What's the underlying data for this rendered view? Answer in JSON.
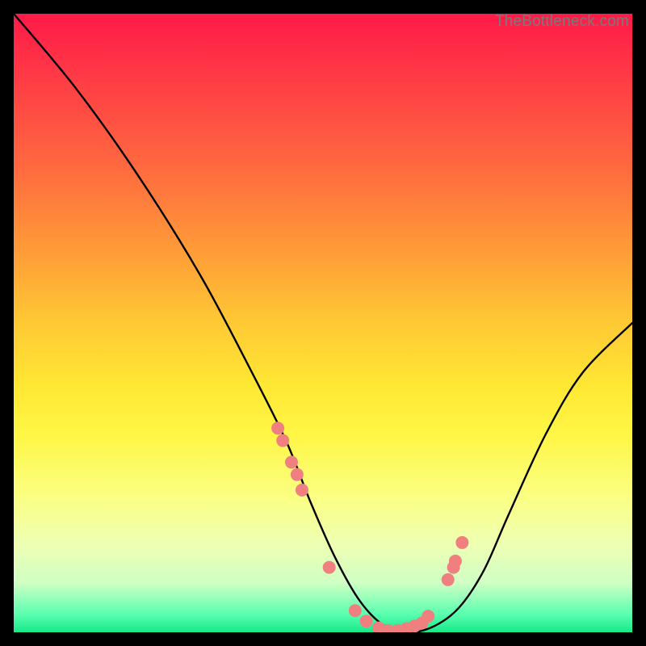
{
  "watermark": "TheBottleneck.com",
  "chart_data": {
    "type": "line",
    "title": "",
    "xlabel": "",
    "ylabel": "",
    "xlim": [
      0,
      100
    ],
    "ylim": [
      0,
      100
    ],
    "line": {
      "name": "curve",
      "x": [
        0,
        10,
        20,
        30,
        38,
        44,
        48,
        52,
        56,
        60,
        64,
        68,
        72,
        76,
        80,
        86,
        92,
        100
      ],
      "y": [
        100,
        88,
        74,
        58,
        43,
        31,
        21,
        12,
        5,
        1,
        0,
        1,
        4,
        10,
        19,
        32,
        42,
        50
      ]
    },
    "scatter_points": {
      "name": "dots",
      "color": "#f08080",
      "x": [
        42.7,
        43.5,
        44.9,
        45.8,
        46.6,
        51.0,
        55.2,
        57.0,
        59.0,
        60.5,
        62.1,
        63.5,
        64.8,
        66.0,
        67.0,
        70.2,
        71.1,
        71.4,
        72.5
      ],
      "y": [
        33.0,
        31.0,
        27.5,
        25.5,
        23.0,
        10.5,
        3.5,
        1.8,
        0.7,
        0.3,
        0.3,
        0.6,
        1.0,
        1.5,
        2.6,
        8.5,
        10.5,
        11.5,
        14.5
      ]
    }
  }
}
